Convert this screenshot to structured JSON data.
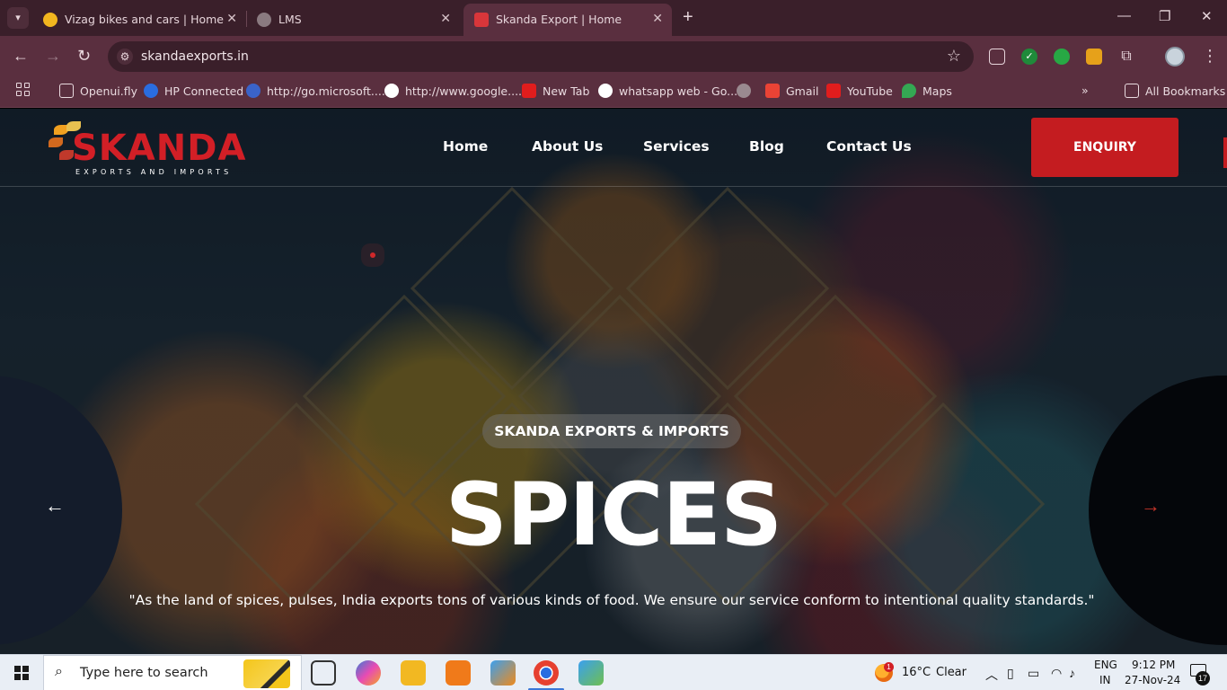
{
  "browser": {
    "tabs": [
      {
        "title": "Vizag bikes and cars | Home",
        "favicon": "location-pin-icon",
        "active": false
      },
      {
        "title": "LMS",
        "favicon": "globe-icon",
        "active": false
      },
      {
        "title": "Skanda Export | Home",
        "favicon": "skanda-icon",
        "active": true
      }
    ],
    "url": "skandaexports.in",
    "bookmarks": [
      {
        "label": "Openui.fly",
        "icon": "folder-icon"
      },
      {
        "label": "HP Connected",
        "icon": "hp-icon"
      },
      {
        "label": "http://go.microsoft....",
        "icon": "microsoft-icon"
      },
      {
        "label": "http://www.google....",
        "icon": "google-icon"
      },
      {
        "label": "New Tab",
        "icon": "youtube-icon"
      },
      {
        "label": "whatsapp web - Go...",
        "icon": "google-icon"
      },
      {
        "label": "",
        "icon": "globe-icon"
      },
      {
        "label": "Gmail",
        "icon": "gmail-icon"
      },
      {
        "label": "YouTube",
        "icon": "youtube-icon"
      },
      {
        "label": "Maps",
        "icon": "maps-icon"
      }
    ],
    "all_bookmarks": "All Bookmarks"
  },
  "site": {
    "logo": {
      "brand": "SKANDA",
      "tagline": "EXPORTS AND IMPORTS"
    },
    "nav": [
      "Home",
      "About Us",
      "Services",
      "Blog",
      "Contact Us"
    ],
    "enquiry": "ENQUIRY",
    "hero": {
      "eyebrow": "SKANDA EXPORTS & IMPORTS",
      "title": "SPICES",
      "quote": "\"As the land of spices, pulses, India exports tons of various kinds of food. We ensure our service conform to intentional quality standards.\""
    }
  },
  "taskbar": {
    "search_placeholder": "Type here to search",
    "weather": {
      "temp": "16°C",
      "condition": "Clear",
      "badge": "1"
    },
    "lang": {
      "line1": "ENG",
      "line2": "IN"
    },
    "time": "9:12 PM",
    "date": "27-Nov-24",
    "notifications": "17"
  },
  "colors": {
    "brand_red": "#c41c20",
    "chrome_dark": "#3a1f2a",
    "chrome_toolbar": "#5a2f3f"
  }
}
